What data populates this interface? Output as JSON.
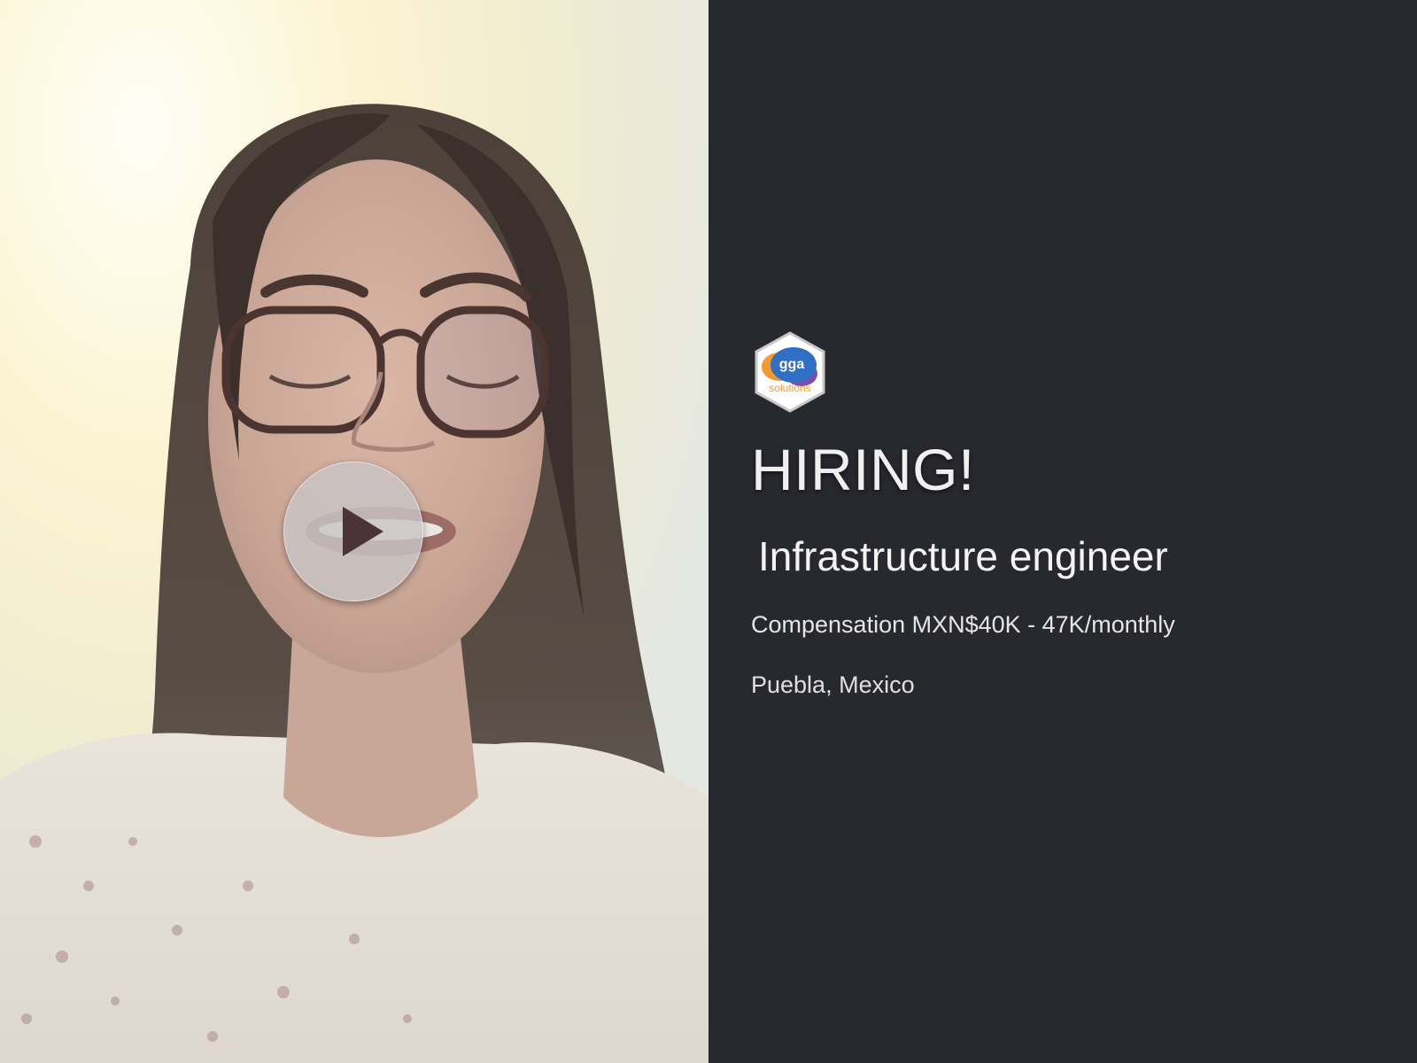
{
  "video": {
    "play_icon": "play-icon",
    "description_hidden": true
  },
  "logo": {
    "icon": "company-logo-icon",
    "text_top": "gga",
    "text_bottom": "solutions"
  },
  "job": {
    "headline": "HIRING!",
    "title": "Infrastructure engineer",
    "compensation": "Compensation MXN$40K - 47K/monthly",
    "location": "Puebla, Mexico"
  },
  "colors": {
    "panel_background": "#28292e",
    "text": "#f2f2f2",
    "logo_blue": "#2f6fc4",
    "logo_orange": "#f39a2c",
    "logo_purple": "#7a4fb0"
  }
}
